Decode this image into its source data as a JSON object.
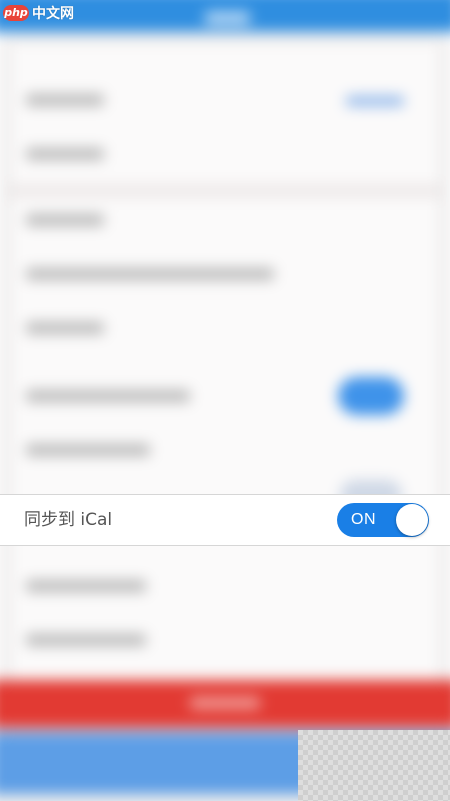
{
  "watermark": {
    "badge": "php",
    "text": "中文网"
  },
  "setting_row": {
    "label": "同步到 iCal",
    "toggle_state": "ON",
    "toggle_on": true
  },
  "colors": {
    "toggle_on": "#1a7fe6",
    "header_blue": "#2f8ee0",
    "danger_red": "#e23a33",
    "watermark_red": "#e8443a"
  }
}
